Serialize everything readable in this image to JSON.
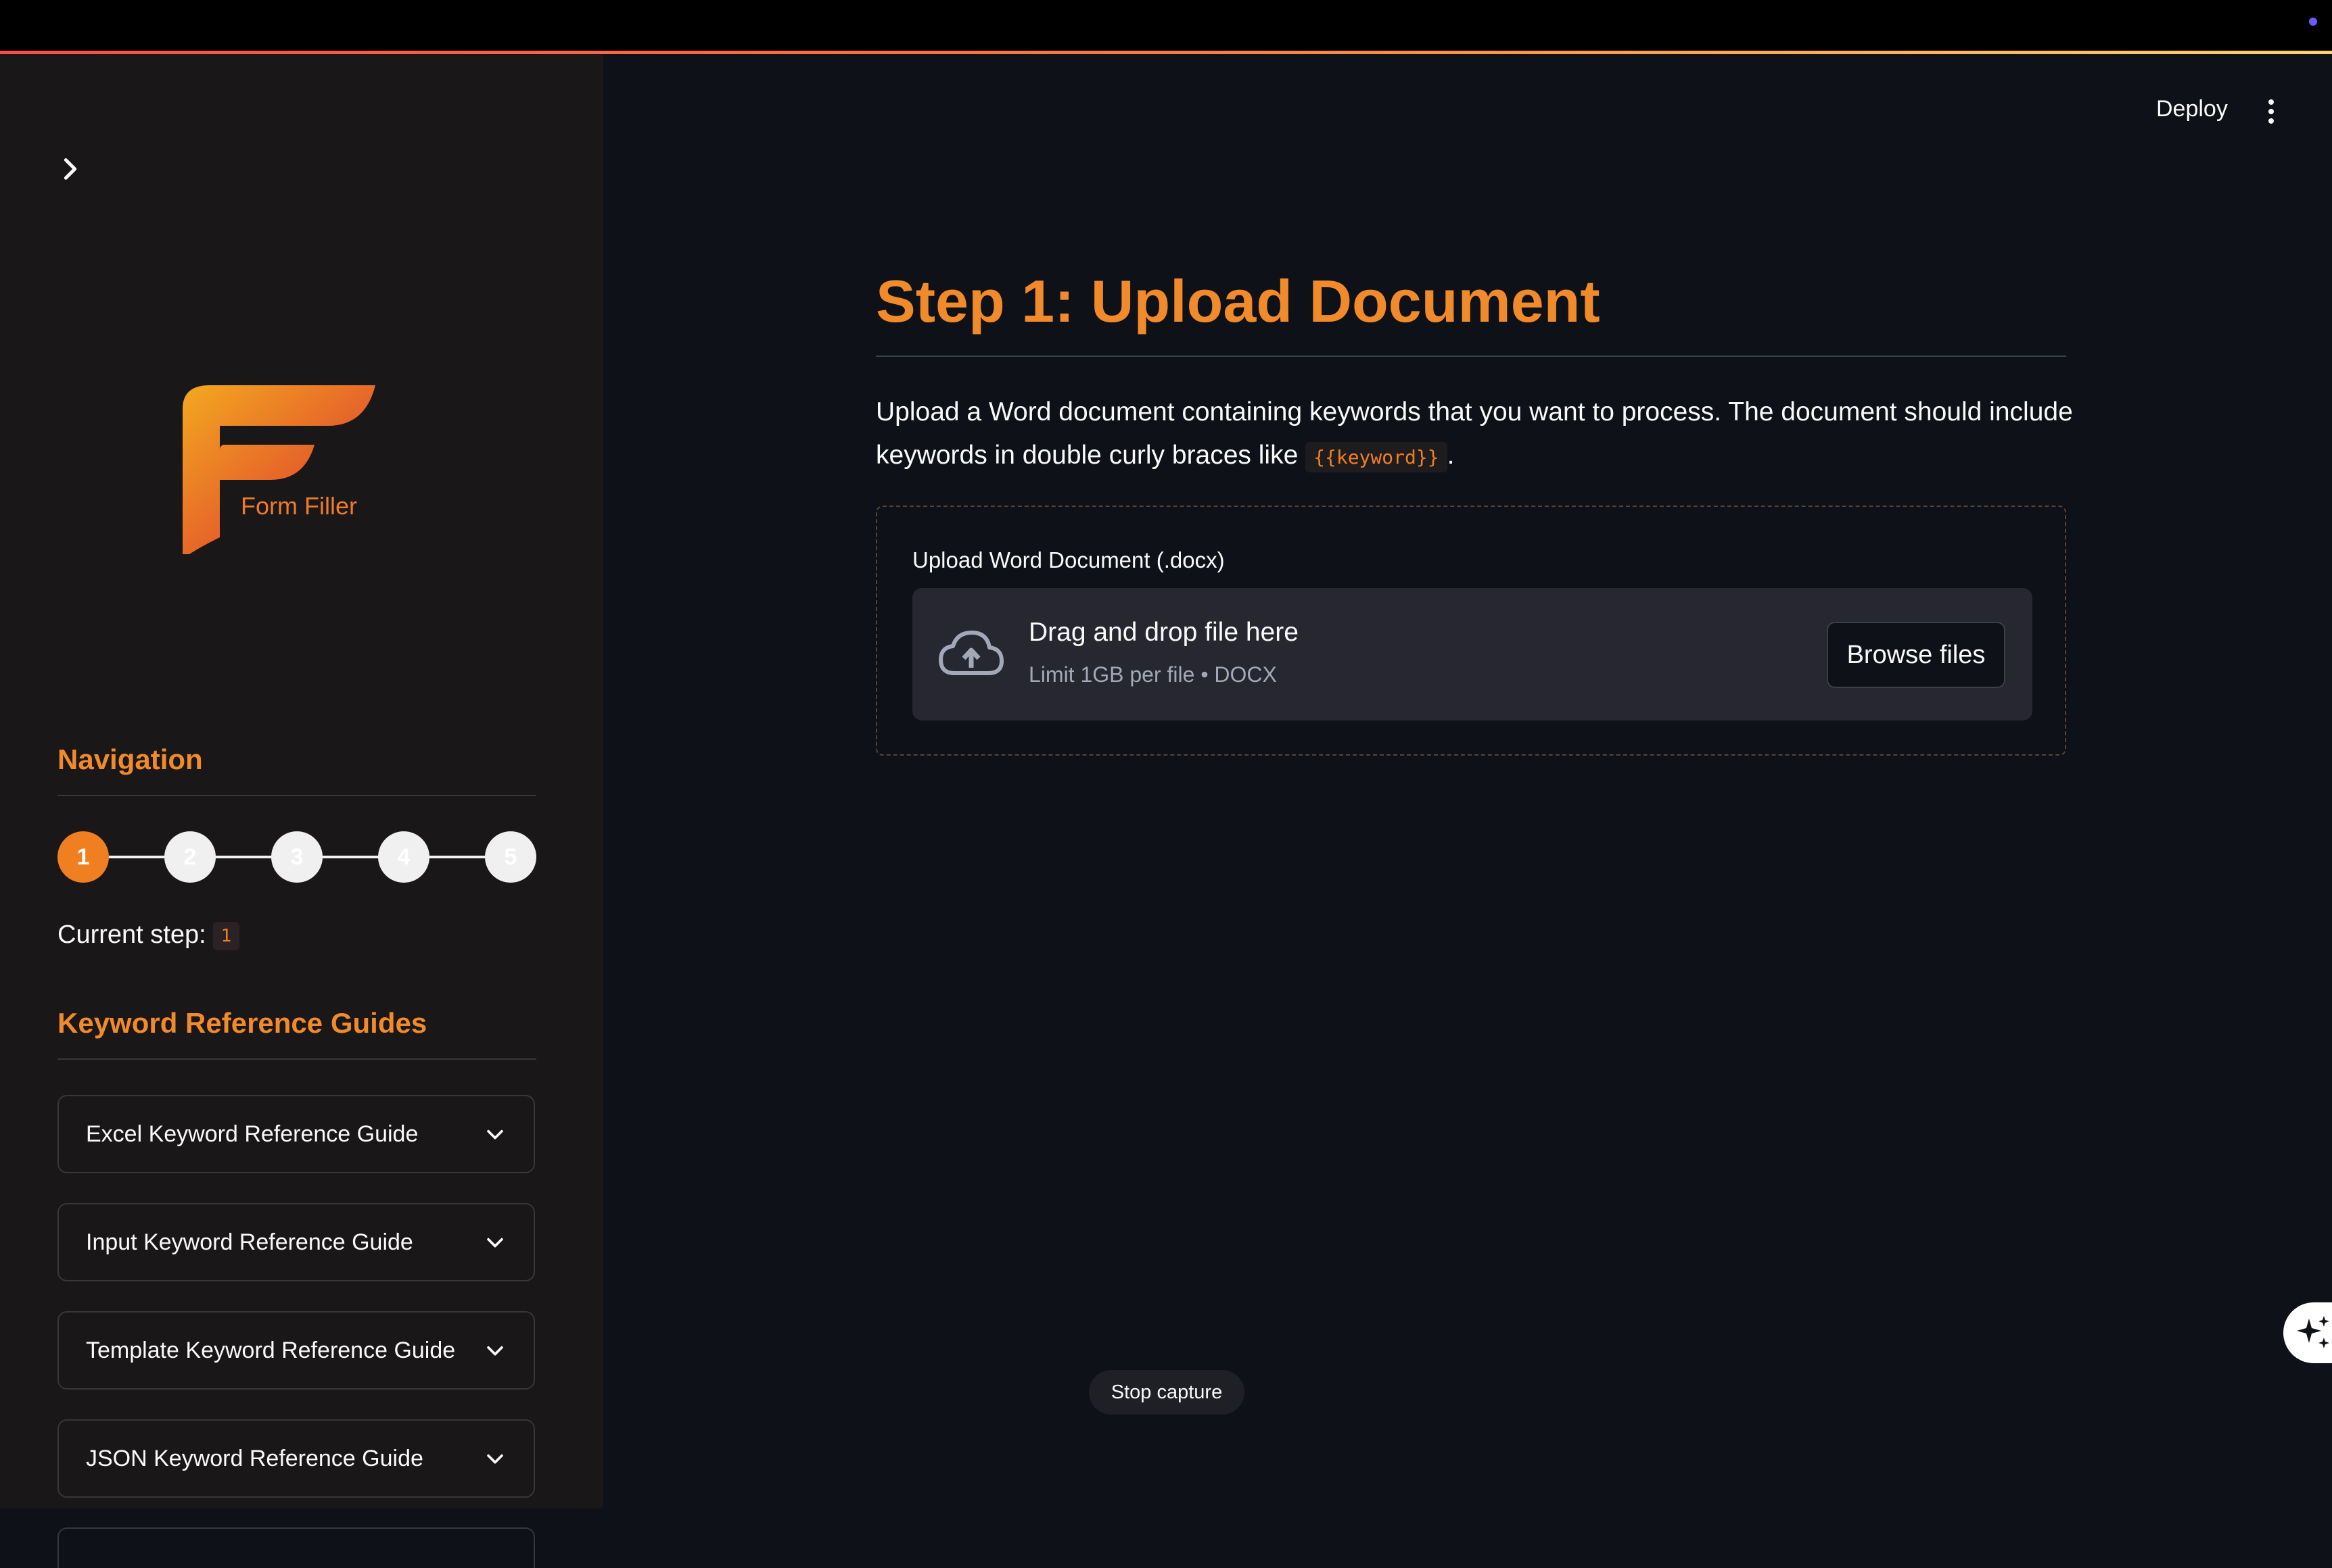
{
  "header": {
    "deploy_label": "Deploy"
  },
  "sidebar": {
    "logo_text": "Form Filler",
    "navigation_heading": "Navigation",
    "steps": [
      "1",
      "2",
      "3",
      "4",
      "5"
    ],
    "active_step": 1,
    "current_step_label": "Current step:",
    "current_step_value": "1",
    "guides_heading": "Keyword Reference Guides",
    "guides": [
      {
        "label": "Excel Keyword Reference Guide"
      },
      {
        "label": "Input Keyword Reference Guide"
      },
      {
        "label": "Template Keyword Reference Guide"
      },
      {
        "label": "JSON Keyword Reference Guide"
      }
    ]
  },
  "main": {
    "title": "Step 1: Upload Document",
    "description_before": "Upload a Word document containing keywords that you want to process. The document should include keywords in double curly braces like ",
    "description_code": "{{keyword}}",
    "description_after": ".",
    "uploader": {
      "label": "Upload Word Document (.docx)",
      "drop_title": "Drag and drop file here",
      "drop_sub": "Limit 1GB per file • DOCX",
      "browse_label": "Browse files"
    }
  },
  "overlay": {
    "stop_capture_label": "Stop capture"
  },
  "colors": {
    "accent": "#f08a2a",
    "background": "#0e1117",
    "sidebar": "#1a1719"
  }
}
